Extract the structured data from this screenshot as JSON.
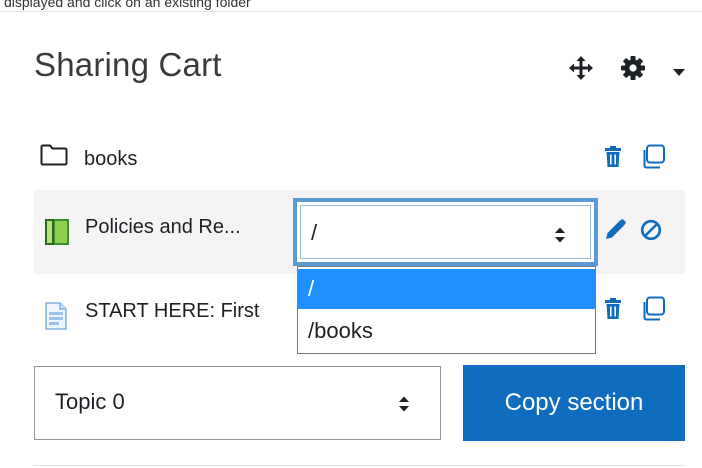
{
  "caption": "displayed and click on an existing folder",
  "block": {
    "title": "Sharing Cart",
    "icons": [
      "move-icon",
      "gear-icon",
      "caret-down-icon"
    ]
  },
  "items": [
    {
      "label": "books",
      "icon": "folder-icon",
      "actions": [
        "trash-icon",
        "copy-icon"
      ]
    },
    {
      "label": "Policies and Re...",
      "icon": "book-icon",
      "actions": [
        "pencil-icon",
        "cancel-icon"
      ]
    },
    {
      "label": "START HERE: First",
      "icon": "page-icon",
      "actions": [
        "trash-icon",
        "copy-icon"
      ]
    }
  ],
  "folder_select": {
    "value": "/",
    "options": [
      "/",
      "/books"
    ],
    "highlighted_index": 0
  },
  "section_select": {
    "value": "Topic 0"
  },
  "copy_button": {
    "label": "Copy section"
  },
  "colors": {
    "primary": "#0f6cbf",
    "highlight": "#1e90ff",
    "focus_border": "#5b9bd5",
    "row_bg": "#f4f4f4"
  }
}
